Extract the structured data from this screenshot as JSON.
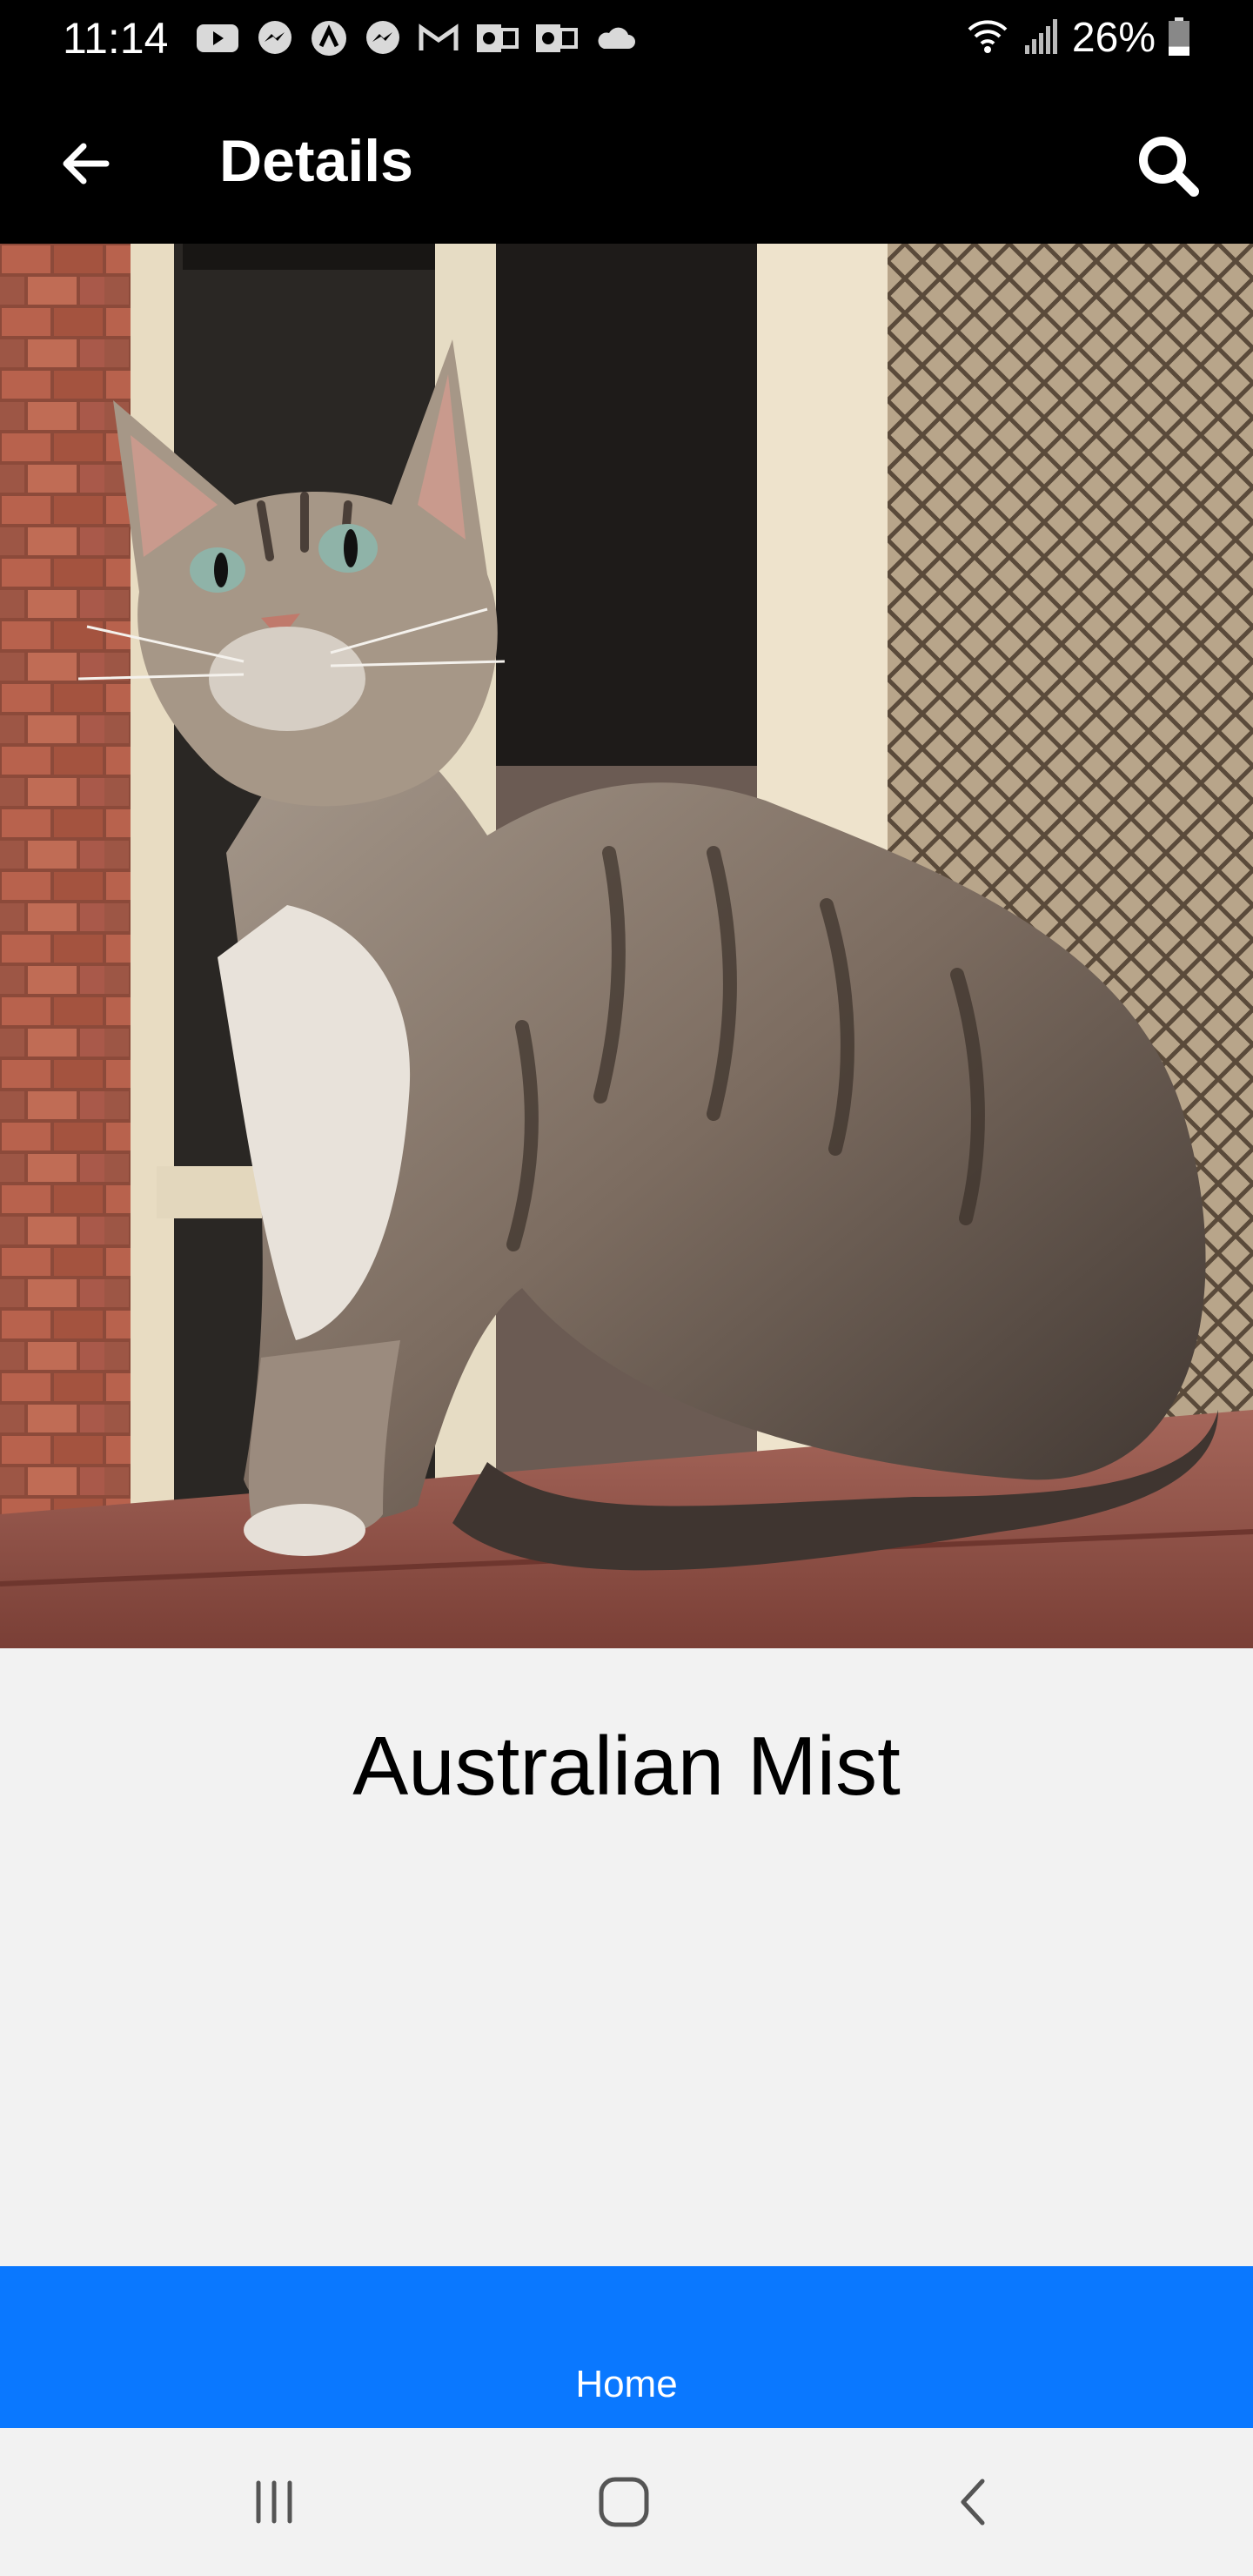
{
  "status_bar": {
    "time": "11:14",
    "battery_percent": "26%",
    "notification_icons": [
      "youtube-icon",
      "messenger-icon",
      "app-a-icon",
      "messenger-icon",
      "gmail-icon",
      "outlook-icon",
      "outlook-icon",
      "cloud-icon"
    ],
    "battery_level": 0.26
  },
  "app_bar": {
    "title": "Details",
    "back_icon": "arrow-left-icon",
    "search_icon": "search-icon"
  },
  "content": {
    "breed_name": "Australian Mist"
  },
  "tab_bar": {
    "home_label": "Home",
    "accent_color": "#0a78ff"
  },
  "system_nav": {
    "buttons": [
      "recents-icon",
      "home-icon",
      "back-icon"
    ]
  }
}
